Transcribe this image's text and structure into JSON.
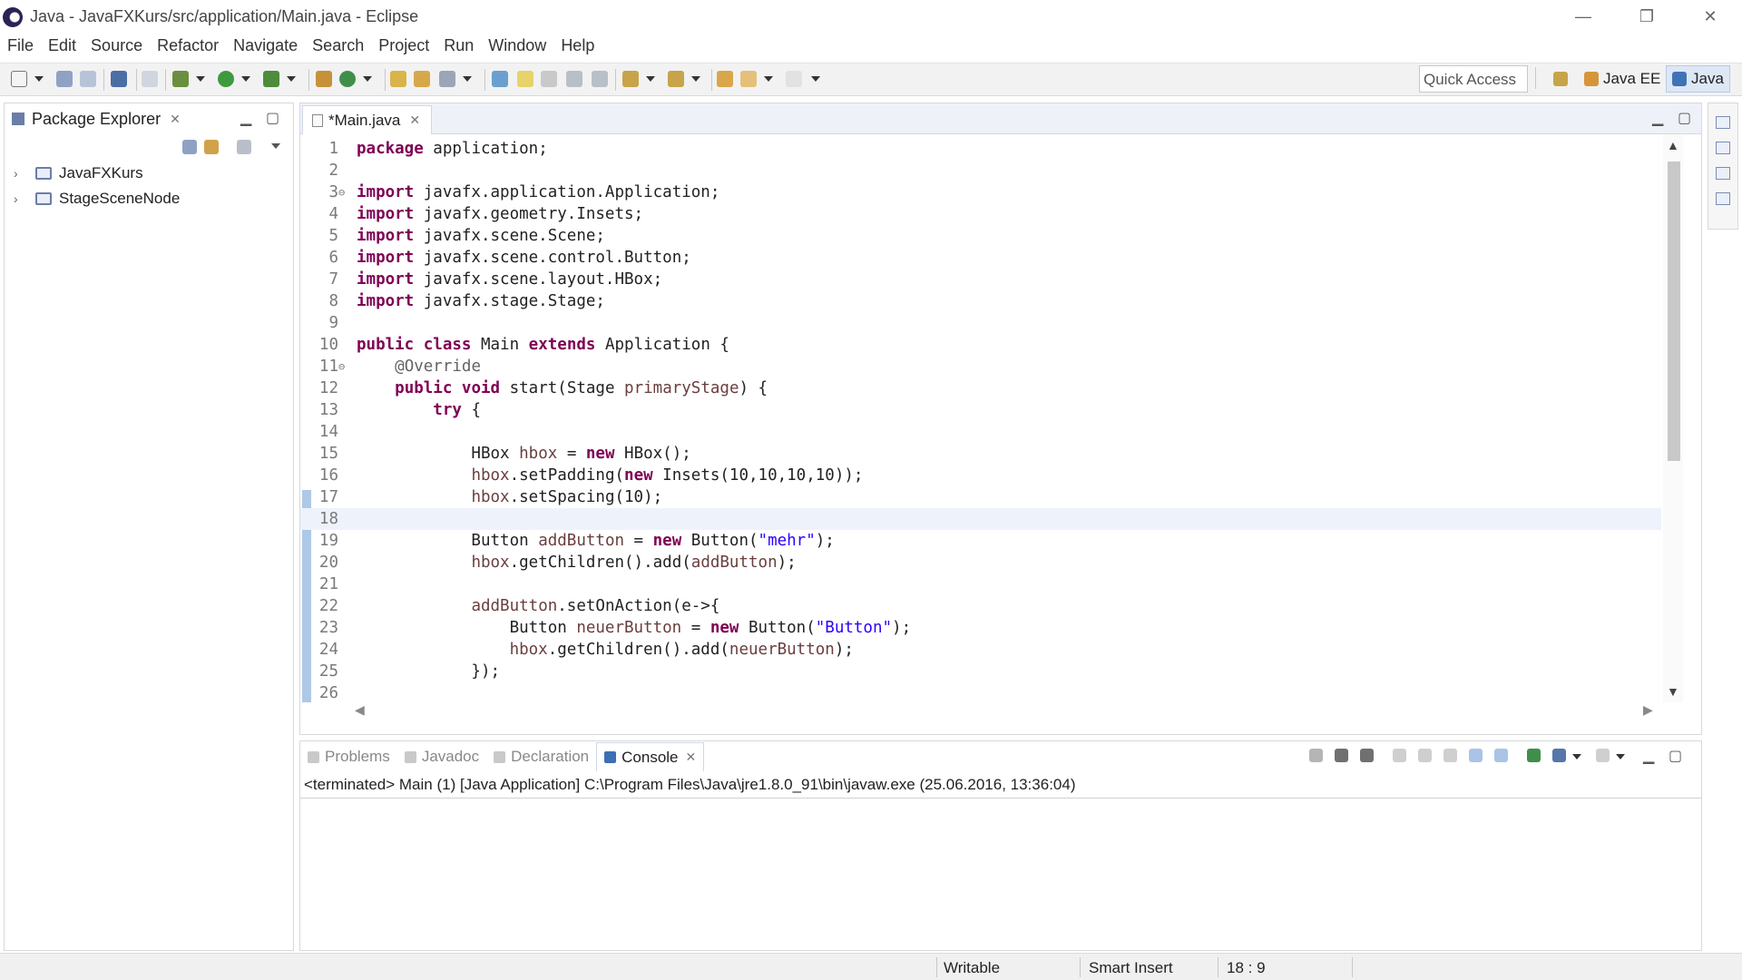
{
  "window": {
    "title": "Java - JavaFXKurs/src/application/Main.java - Eclipse",
    "minimize": "—",
    "restore": "❐",
    "close": "✕"
  },
  "menu": [
    "File",
    "Edit",
    "Source",
    "Refactor",
    "Navigate",
    "Search",
    "Project",
    "Run",
    "Window",
    "Help"
  ],
  "toolbar": {
    "quick_access_placeholder": "Quick Access",
    "perspectives": [
      "Java EE",
      "Java"
    ]
  },
  "package_explorer": {
    "title": "Package Explorer",
    "projects": [
      "JavaFXKurs",
      "StageSceneNode"
    ]
  },
  "editor": {
    "tab_label": "*Main.java",
    "current_line": 18,
    "lines": [
      {
        "n": "1",
        "tokens": [
          [
            "kw",
            "package"
          ],
          [
            "txt",
            " application;"
          ]
        ]
      },
      {
        "n": "2",
        "tokens": []
      },
      {
        "n": "3",
        "fold": "⊖",
        "tokens": [
          [
            "kw",
            "import"
          ],
          [
            "txt",
            " javafx.application.Application;"
          ]
        ]
      },
      {
        "n": "4",
        "tokens": [
          [
            "kw",
            "import"
          ],
          [
            "txt",
            " javafx.geometry.Insets;"
          ]
        ]
      },
      {
        "n": "5",
        "tokens": [
          [
            "kw",
            "import"
          ],
          [
            "txt",
            " javafx.scene.Scene;"
          ]
        ]
      },
      {
        "n": "6",
        "tokens": [
          [
            "kw",
            "import"
          ],
          [
            "txt",
            " javafx.scene.control.Button;"
          ]
        ]
      },
      {
        "n": "7",
        "tokens": [
          [
            "kw",
            "import"
          ],
          [
            "txt",
            " javafx.scene.layout.HBox;"
          ]
        ]
      },
      {
        "n": "8",
        "tokens": [
          [
            "kw",
            "import"
          ],
          [
            "txt",
            " javafx.stage.Stage;"
          ]
        ]
      },
      {
        "n": "9",
        "tokens": []
      },
      {
        "n": "10",
        "tokens": [
          [
            "kw",
            "public"
          ],
          [
            "txt",
            " "
          ],
          [
            "kw",
            "class"
          ],
          [
            "txt",
            " Main "
          ],
          [
            "kw",
            "extends"
          ],
          [
            "txt",
            " Application {"
          ]
        ]
      },
      {
        "n": "11",
        "fold": "⊖",
        "tokens": [
          [
            "txt",
            "    "
          ],
          [
            "ann",
            "@Override"
          ]
        ]
      },
      {
        "n": "12",
        "tokens": [
          [
            "txt",
            "    "
          ],
          [
            "kw",
            "public"
          ],
          [
            "txt",
            " "
          ],
          [
            "kw",
            "void"
          ],
          [
            "txt",
            " start(Stage "
          ],
          [
            "var",
            "primaryStage"
          ],
          [
            "txt",
            ") {"
          ]
        ]
      },
      {
        "n": "13",
        "tokens": [
          [
            "txt",
            "        "
          ],
          [
            "kw",
            "try"
          ],
          [
            "txt",
            " {"
          ]
        ]
      },
      {
        "n": "14",
        "tokens": []
      },
      {
        "n": "15",
        "tokens": [
          [
            "txt",
            "            HBox "
          ],
          [
            "var",
            "hbox"
          ],
          [
            "txt",
            " = "
          ],
          [
            "kw",
            "new"
          ],
          [
            "txt",
            " HBox();"
          ]
        ]
      },
      {
        "n": "16",
        "tokens": [
          [
            "txt",
            "            "
          ],
          [
            "var",
            "hbox"
          ],
          [
            "txt",
            ".setPadding("
          ],
          [
            "kw",
            "new"
          ],
          [
            "txt",
            " Insets(10,10,10,10));"
          ]
        ]
      },
      {
        "n": "17",
        "tokens": [
          [
            "txt",
            "            "
          ],
          [
            "var",
            "hbox"
          ],
          [
            "txt",
            ".setSpacing(10);"
          ]
        ]
      },
      {
        "n": "18",
        "tokens": []
      },
      {
        "n": "19",
        "tokens": [
          [
            "txt",
            "            Button "
          ],
          [
            "var",
            "addButton"
          ],
          [
            "txt",
            " = "
          ],
          [
            "kw",
            "new"
          ],
          [
            "txt",
            " Button("
          ],
          [
            "str",
            "\"mehr\""
          ],
          [
            "txt",
            ");"
          ]
        ]
      },
      {
        "n": "20",
        "tokens": [
          [
            "txt",
            "            "
          ],
          [
            "var",
            "hbox"
          ],
          [
            "txt",
            ".getChildren().add("
          ],
          [
            "var",
            "addButton"
          ],
          [
            "txt",
            ");"
          ]
        ]
      },
      {
        "n": "21",
        "tokens": []
      },
      {
        "n": "22",
        "tokens": [
          [
            "txt",
            "            "
          ],
          [
            "var",
            "addButton"
          ],
          [
            "txt",
            ".setOnAction(e->{"
          ]
        ]
      },
      {
        "n": "23",
        "tokens": [
          [
            "txt",
            "                Button "
          ],
          [
            "var",
            "neuerButton"
          ],
          [
            "txt",
            " = "
          ],
          [
            "kw",
            "new"
          ],
          [
            "txt",
            " Button("
          ],
          [
            "str",
            "\"Button\""
          ],
          [
            "txt",
            ");"
          ]
        ]
      },
      {
        "n": "24",
        "tokens": [
          [
            "txt",
            "                "
          ],
          [
            "var",
            "hbox"
          ],
          [
            "txt",
            ".getChildren().add("
          ],
          [
            "var",
            "neuerButton"
          ],
          [
            "txt",
            ");"
          ]
        ]
      },
      {
        "n": "25",
        "tokens": [
          [
            "txt",
            "            });"
          ]
        ]
      },
      {
        "n": "26",
        "tokens": []
      }
    ]
  },
  "bottom_panel": {
    "tabs": [
      "Problems",
      "Javadoc",
      "Declaration",
      "Console"
    ],
    "active_tab": "Console",
    "console_status": "<terminated> Main (1) [Java Application] C:\\Program Files\\Java\\jre1.8.0_91\\bin\\javaw.exe (25.06.2016, 13:36:04)"
  },
  "statusbar": {
    "mode": "Writable",
    "insert": "Smart Insert",
    "position": "18 : 9"
  },
  "colors": {
    "keyword": "#7f0055",
    "variable": "#6a3e3e",
    "string": "#2a00ff",
    "annotation": "#646464"
  }
}
